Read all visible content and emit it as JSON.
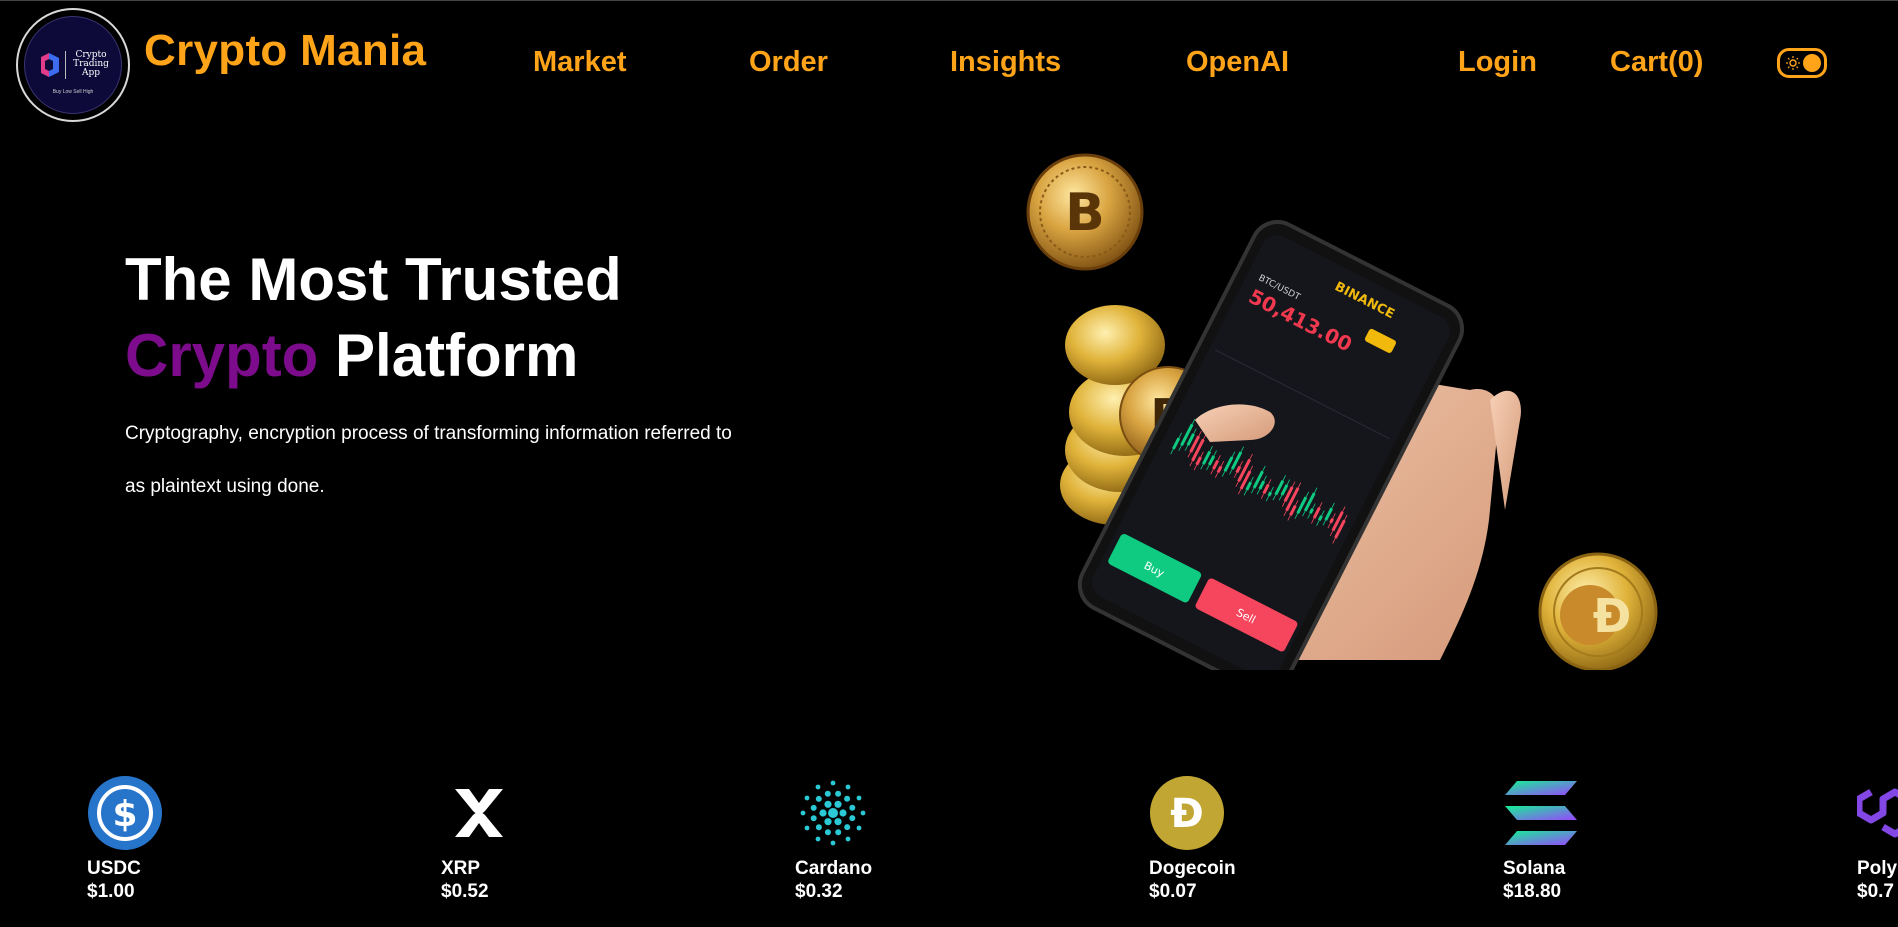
{
  "header": {
    "logo_text": "Crypto\nTrading\nApp",
    "logo_tagline": "Buy Low Sell High",
    "brand": "Crypto Mania",
    "nav": {
      "market": "Market",
      "order": "Order",
      "insights": "Insights",
      "openai": "OpenAI",
      "login": "Login",
      "cart": "Cart(0)"
    },
    "theme_toggle_icon": "sun-icon"
  },
  "hero": {
    "title_line1": "The Most Trusted",
    "title_accent": "Crypto",
    "title_rest": "Platform",
    "description": "Cryptography, encryption process of transforming information referred to as plaintext using done."
  },
  "phone": {
    "exchange": "BINANCE",
    "pair": "BTC/USDT",
    "price": "50,413.00",
    "buy_label": "Buy",
    "sell_label": "Sell"
  },
  "colors": {
    "accent": "#ffa319",
    "crypto_purple": "#7d0c8c",
    "background": "#000000"
  },
  "coins": [
    {
      "name": "USDC",
      "price": "$1.00",
      "icon": "usdc-icon"
    },
    {
      "name": "XRP",
      "price": "$0.52",
      "icon": "xrp-icon"
    },
    {
      "name": "Cardano",
      "price": "$0.32",
      "icon": "cardano-icon"
    },
    {
      "name": "Dogecoin",
      "price": "$0.07",
      "icon": "dogecoin-icon"
    },
    {
      "name": "Solana",
      "price": "$18.80",
      "icon": "solana-icon"
    },
    {
      "name": "Poly",
      "price": "$0.7",
      "icon": "polygon-icon"
    }
  ]
}
